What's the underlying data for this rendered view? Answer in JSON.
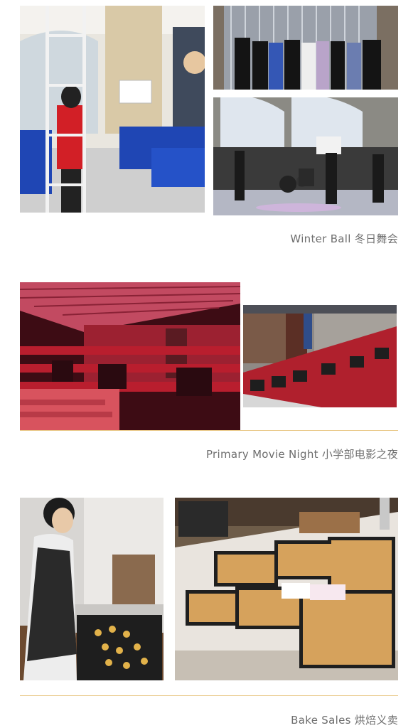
{
  "sections": [
    {
      "caption": "Winter Ball 冬日舞会"
    },
    {
      "caption": "Primary Movie Night 小学部电影之夜"
    },
    {
      "caption": "Bake Sales 烘焙义卖"
    }
  ],
  "colors": {
    "divider": "#e9c98a",
    "caption": "#6e6e6e"
  }
}
